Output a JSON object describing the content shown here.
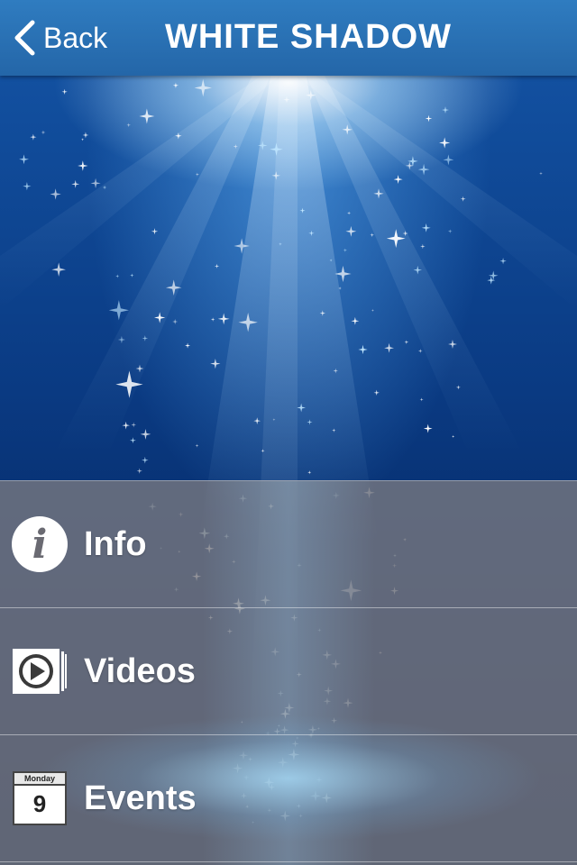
{
  "navbar": {
    "back_label": "Back",
    "title": "WHITE SHADOW"
  },
  "menu": {
    "items": [
      {
        "label": "Info",
        "icon": "info-icon"
      },
      {
        "label": "Videos",
        "icon": "play-video-icon"
      },
      {
        "label": "Events",
        "icon": "calendar-icon"
      }
    ],
    "calendar": {
      "weekday": "Monday",
      "day": "9"
    }
  },
  "colors": {
    "navbar": "#2a6fb4",
    "background": "#0a3a82",
    "menu_overlay": "#78787f"
  }
}
